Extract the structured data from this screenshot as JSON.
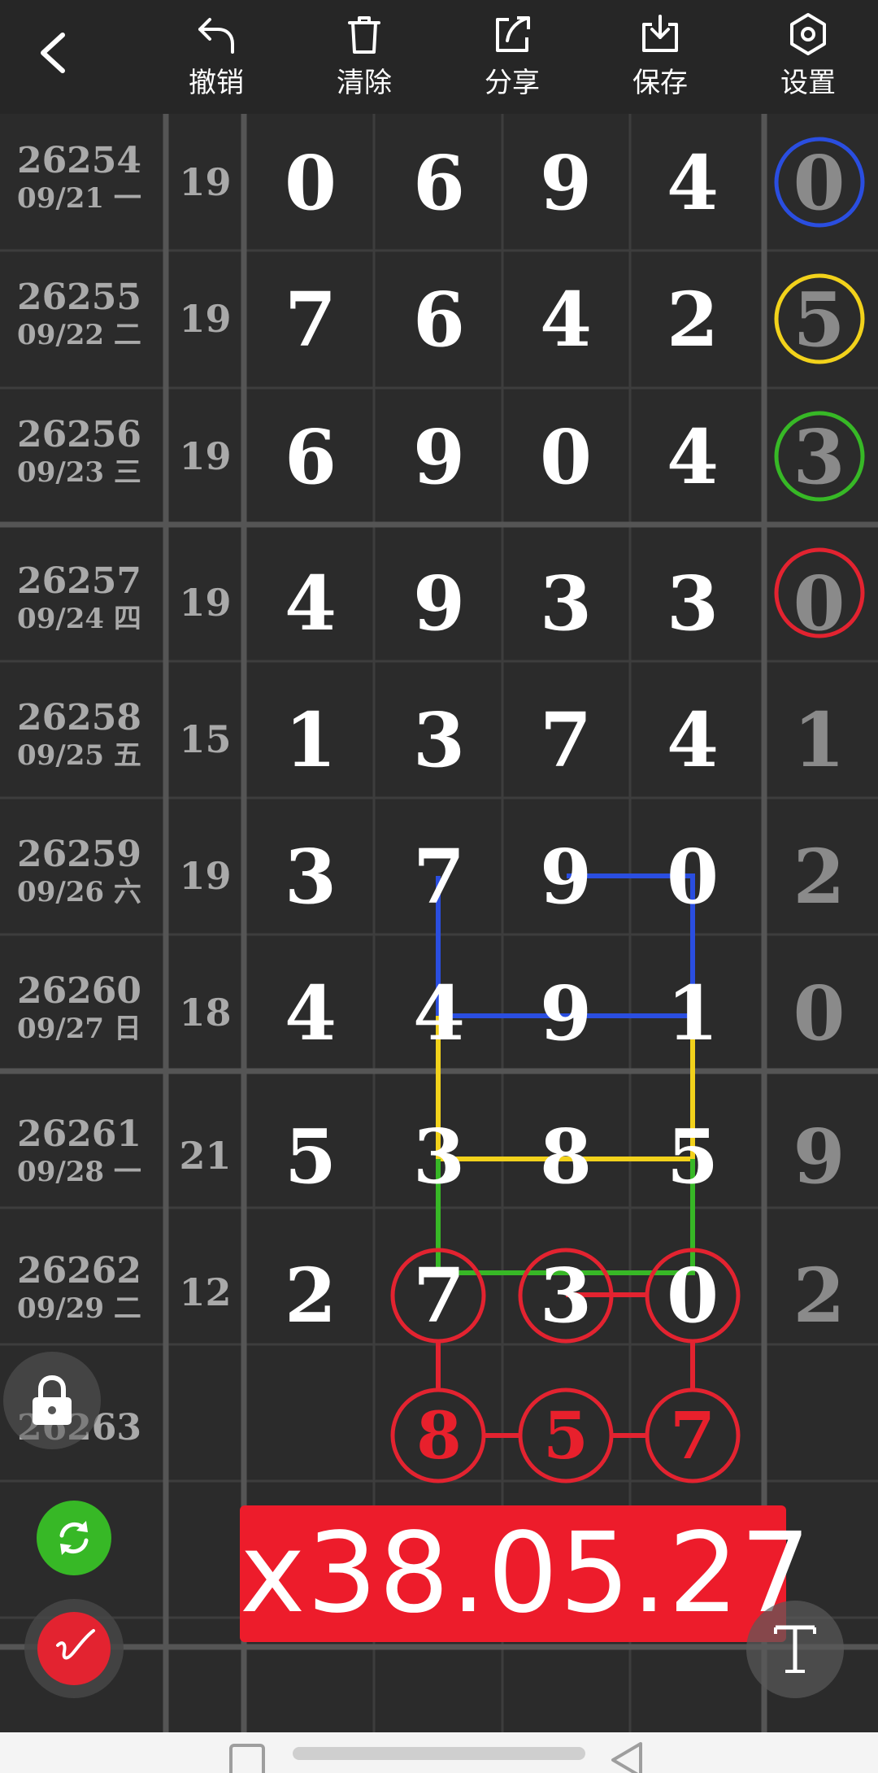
{
  "toolbar": {
    "undo_label": "撤销",
    "clear_label": "清除",
    "share_label": "分享",
    "save_label": "保存",
    "settings_label": "设置"
  },
  "rows": [
    {
      "issue": "26254",
      "date": "09/21 一",
      "sum": "19",
      "digits": [
        "0",
        "6",
        "9",
        "4"
      ],
      "right": "0",
      "right_ring": "#2a4ee0"
    },
    {
      "issue": "26255",
      "date": "09/22 二",
      "sum": "19",
      "digits": [
        "7",
        "6",
        "4",
        "2"
      ],
      "right": "5",
      "right_ring": "#f2d21b"
    },
    {
      "issue": "26256",
      "date": "09/23 三",
      "sum": "19",
      "digits": [
        "6",
        "9",
        "0",
        "4"
      ],
      "right": "3",
      "right_ring": "#37b826"
    },
    {
      "issue": "26257",
      "date": "09/24 四",
      "sum": "19",
      "digits": [
        "4",
        "9",
        "3",
        "3"
      ],
      "right": "0",
      "right_ring": "#e32330"
    },
    {
      "issue": "26258",
      "date": "09/25 五",
      "sum": "15",
      "digits": [
        "1",
        "3",
        "7",
        "4"
      ],
      "right": "1"
    },
    {
      "issue": "26259",
      "date": "09/26 六",
      "sum": "19",
      "digits": [
        "3",
        "7",
        "9",
        "0"
      ],
      "right": "2"
    },
    {
      "issue": "26260",
      "date": "09/27 日",
      "sum": "18",
      "digits": [
        "4",
        "4",
        "9",
        "1"
      ],
      "right": "0"
    },
    {
      "issue": "26261",
      "date": "09/28 一",
      "sum": "21",
      "digits": [
        "5",
        "3",
        "8",
        "5"
      ],
      "right": "9"
    },
    {
      "issue": "26262",
      "date": "09/29 二",
      "sum": "12",
      "digits": [
        "2",
        "7",
        "3",
        "0"
      ],
      "right": "2"
    }
  ],
  "next_issue": "26263",
  "prediction": [
    "8",
    "5",
    "7"
  ],
  "result_text": "x38.05.27",
  "colors": {
    "blue": "#2a4ee0",
    "yellow": "#f2d21b",
    "green": "#37b826",
    "red": "#e32330",
    "banner": "#ed1c2b"
  },
  "icons": [
    "back-arrow-icon",
    "undo-icon",
    "trash-icon",
    "share-icon",
    "download-icon",
    "settings-icon",
    "lock-icon",
    "refresh-icon",
    "pen-icon",
    "text-tool-icon"
  ]
}
